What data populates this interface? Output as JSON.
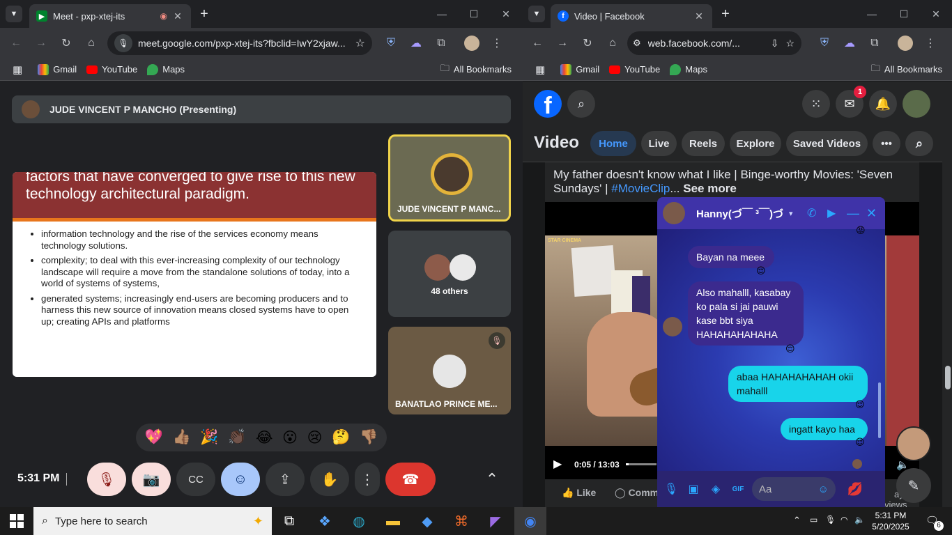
{
  "left_browser": {
    "tab_title": "Meet - pxp-xtej-its",
    "url": "meet.google.com/pxp-xtej-its?fbclid=IwY2xjaw...",
    "bookmarks": [
      "Gmail",
      "YouTube",
      "Maps"
    ],
    "all_bookmarks": "All Bookmarks"
  },
  "meet": {
    "presenter_label": "JUDE VINCENT P MANCHO (Presenting)",
    "slide": {
      "heading": "factors that have converged to give rise to this new technology architectural paradigm.",
      "bullets": [
        "information technology and the rise of the services economy means technology solutions.",
        "complexity; to deal with this ever-increasing complexity of our technology landscape will require a move from the standalone solutions of today, into a world of systems of systems,",
        "generated systems; increasingly end-users are becoming producers and to harness this new source of innovation means closed systems have to open up; creating APIs and platforms"
      ]
    },
    "tiles": [
      {
        "name": "JUDE VINCENT P MANC..."
      },
      {
        "name": "48 others"
      },
      {
        "name": "BANATLAO PRINCE ME..."
      }
    ],
    "reactions": [
      "💖",
      "👍🏽",
      "🎉",
      "👏🏿",
      "😂",
      "😮",
      "😢",
      "🤔",
      "👎🏽"
    ],
    "time": "5:31 PM"
  },
  "right_browser": {
    "tab_title": "Video | Facebook",
    "url": "web.facebook.com/...",
    "bookmarks": [
      "Gmail",
      "YouTube",
      "Maps"
    ],
    "all_bookmarks": "All Bookmarks"
  },
  "facebook": {
    "messenger_badge": "1",
    "page_title": "Video",
    "nav": [
      "Home",
      "Live",
      "Reels",
      "Explore",
      "Saved Videos"
    ],
    "post_text_start": "My father doesn't know what I like | Binge-worthy Movies: 'Seven Sundays' | ",
    "post_hashtag": "#MovieClip",
    "post_ellipsis": "...",
    "see_more": "See more",
    "watermark": "STAR CINEMA",
    "video_time": "0:05 / 13:03",
    "like": "Like",
    "comment": "Comm",
    "right_bits": [
      "ayo",
      "views"
    ]
  },
  "chat": {
    "contact": "Hanny(づ￣ ³￣)づ",
    "messages": [
      {
        "dir": "in",
        "text": "Bayan na meee"
      },
      {
        "dir": "in",
        "text": "Also mahalll, kasabay ko pala si jai pauwi kase bbt siya HAHAHAHAHAHA"
      },
      {
        "dir": "out",
        "text": "abaa HAHAHAHAHAH okii mahalll"
      },
      {
        "dir": "out",
        "text": "ingatt kayo haa"
      }
    ],
    "input_placeholder": "Aa"
  },
  "taskbar": {
    "search_placeholder": "Type here to search",
    "time": "5:31 PM",
    "date": "5/20/2025",
    "notifications": "6"
  }
}
